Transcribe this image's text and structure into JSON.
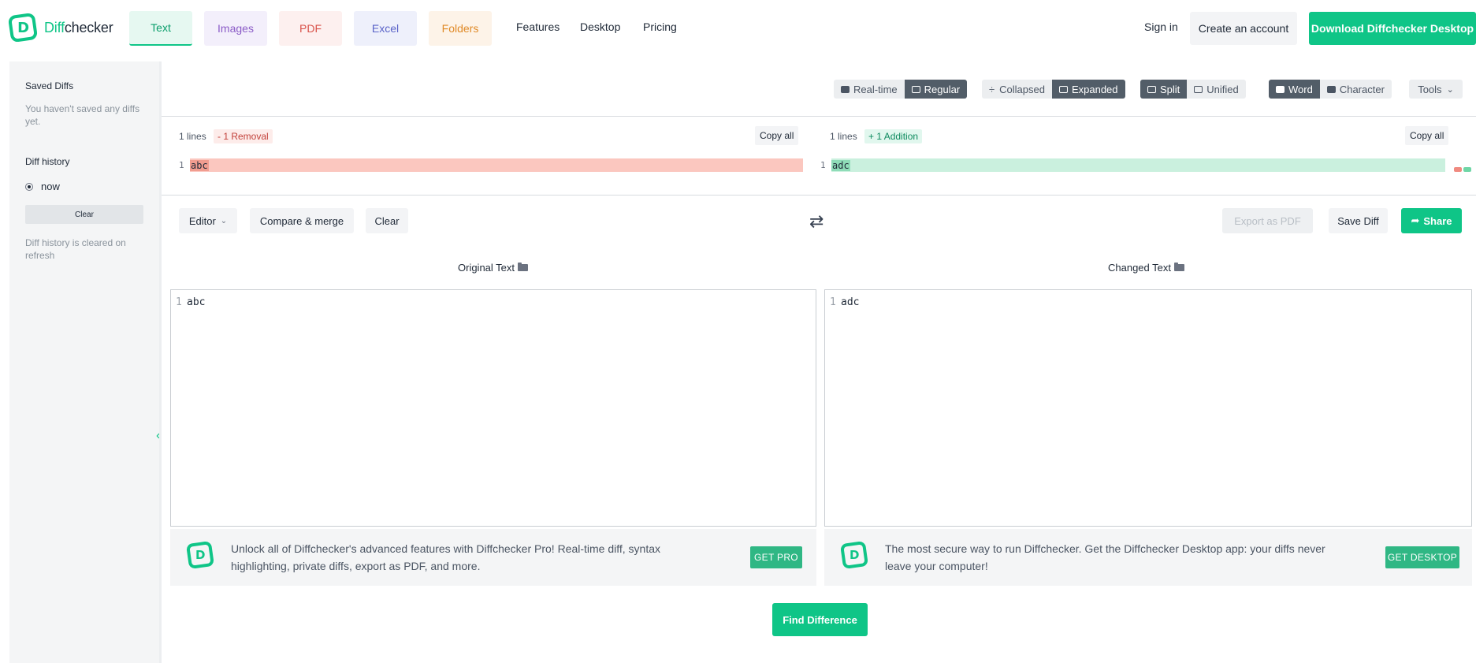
{
  "header": {
    "logo_mark": "D",
    "logo_text_accent": "Diff",
    "logo_text_rest": "checker",
    "tabs": [
      {
        "label": "Text"
      },
      {
        "label": "Images"
      },
      {
        "label": "PDF"
      },
      {
        "label": "Excel"
      },
      {
        "label": "Folders"
      }
    ],
    "nav": {
      "features": "Features",
      "desktop": "Desktop",
      "pricing": "Pricing"
    },
    "sign_in": "Sign in",
    "create_account": "Create an account",
    "download": "Download Diffchecker Desktop"
  },
  "sidebar": {
    "saved_title": "Saved Diffs",
    "saved_empty": "You haven't saved any diffs yet.",
    "history_title": "Diff history",
    "history_items": [
      {
        "label": "now"
      }
    ],
    "clear": "Clear",
    "history_note": "Diff history is cleared on refresh",
    "collapse_icon": "‹"
  },
  "toolbar": {
    "mode": {
      "realtime": "Real-time",
      "regular": "Regular",
      "active": "Regular"
    },
    "view": {
      "collapsed": "Collapsed",
      "expanded": "Expanded",
      "active": "Expanded"
    },
    "layout": {
      "split": "Split",
      "unified": "Unified",
      "active": "Split"
    },
    "precision": {
      "word": "Word",
      "character": "Character",
      "active": "Word"
    },
    "tools": "Tools",
    "tools_chevron": "⌄"
  },
  "result": {
    "left": {
      "lines": "1 lines",
      "badge": "- 1 Removal",
      "copy": "Copy all",
      "line_no": "1",
      "text": "abc"
    },
    "right": {
      "lines": "1 lines",
      "badge": "+ 1 Addition",
      "copy": "Copy all",
      "line_no": "1",
      "text": "adc"
    }
  },
  "actions": {
    "editor": "Editor",
    "editor_chevron": "⌄",
    "compare_merge": "Compare & merge",
    "clear": "Clear",
    "swap_icon": "⇄",
    "export_pdf": "Export as PDF",
    "save_diff": "Save Diff",
    "share": "Share",
    "share_icon": "➦"
  },
  "panes": {
    "original": {
      "title": "Original Text",
      "line_no": "1",
      "text": "abc"
    },
    "changed": {
      "title": "Changed Text",
      "line_no": "1",
      "text": "adc"
    }
  },
  "promos": {
    "pro": {
      "text": "Unlock all of Diffchecker's advanced features with Diffchecker Pro! Real-time diff, syntax highlighting, private diffs, export as PDF, and more.",
      "button": "GET PRO"
    },
    "desktop": {
      "text": "The most secure way to run Diffchecker. Get the Diffchecker Desktop app: your diffs never leave your computer!",
      "button": "GET DESKTOP"
    }
  },
  "find_difference": "Find Difference",
  "colors": {
    "brand": "#0fc587",
    "removal": "#fbc7bf",
    "addition": "#caf0de"
  }
}
